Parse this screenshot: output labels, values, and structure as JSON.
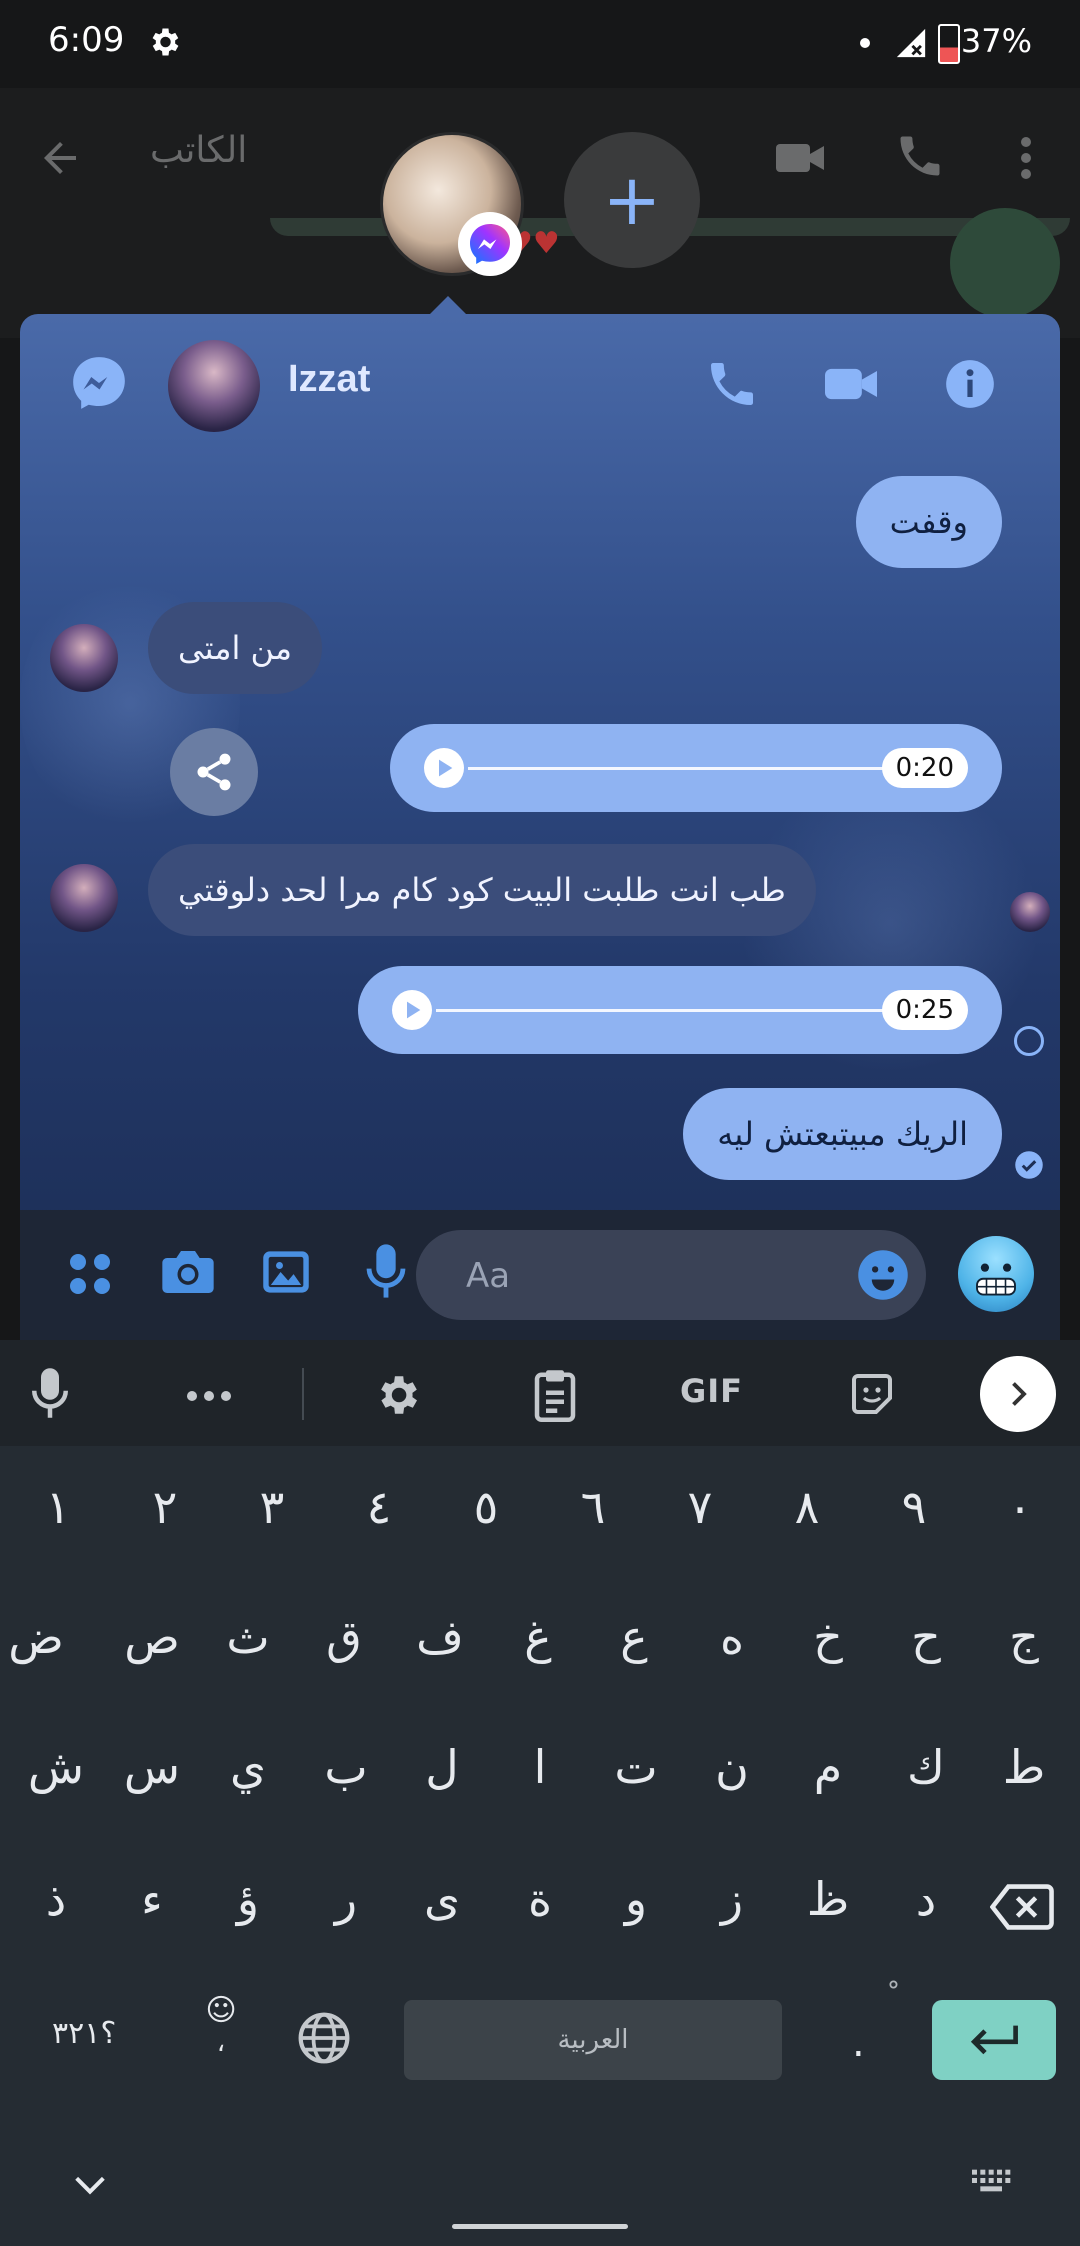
{
  "status_bar": {
    "time": "6:09",
    "battery": "37%"
  },
  "background_app": {
    "title": "الكاتب"
  },
  "chat_head": {
    "add_label": "+"
  },
  "chat": {
    "contact_name": "Izzat",
    "messages": [
      {
        "direction": "out",
        "type": "text",
        "text": "وقفت"
      },
      {
        "direction": "in",
        "type": "text",
        "text": "من امتى"
      },
      {
        "direction": "out",
        "type": "audio",
        "duration": "0:20"
      },
      {
        "direction": "in",
        "type": "text",
        "text": "طب انت طلبت البيت كود كام مرا لحد دلوقتي"
      },
      {
        "direction": "out",
        "type": "audio",
        "duration": "0:25"
      },
      {
        "direction": "out",
        "type": "text",
        "text": "الريك مبيتبعتش ليه"
      }
    ]
  },
  "composer": {
    "placeholder": "Aa"
  },
  "keyboard": {
    "toolbar_gif": "GIF",
    "row_digits": [
      "١",
      "٢",
      "٣",
      "٤",
      "٥",
      "٦",
      "٧",
      "٨",
      "٩",
      "٠"
    ],
    "row1": [
      "ض",
      "ص",
      "ث",
      "ق",
      "ف",
      "غ",
      "ع",
      "ه",
      "خ",
      "ح",
      "ج"
    ],
    "row2": [
      "ش",
      "س",
      "ي",
      "ب",
      "ل",
      "ا",
      "ت",
      "ن",
      "م",
      "ك",
      "ط"
    ],
    "row3": [
      "ذ",
      "ء",
      "ؤ",
      "ر",
      "ى",
      "ة",
      "و",
      "ز",
      "ظ",
      "د"
    ],
    "symbols_key": "؟٣٢١",
    "emoji_key_sub": "،",
    "space_label": "العربية",
    "period_key": ".",
    "period_key_sub": "ْ"
  }
}
